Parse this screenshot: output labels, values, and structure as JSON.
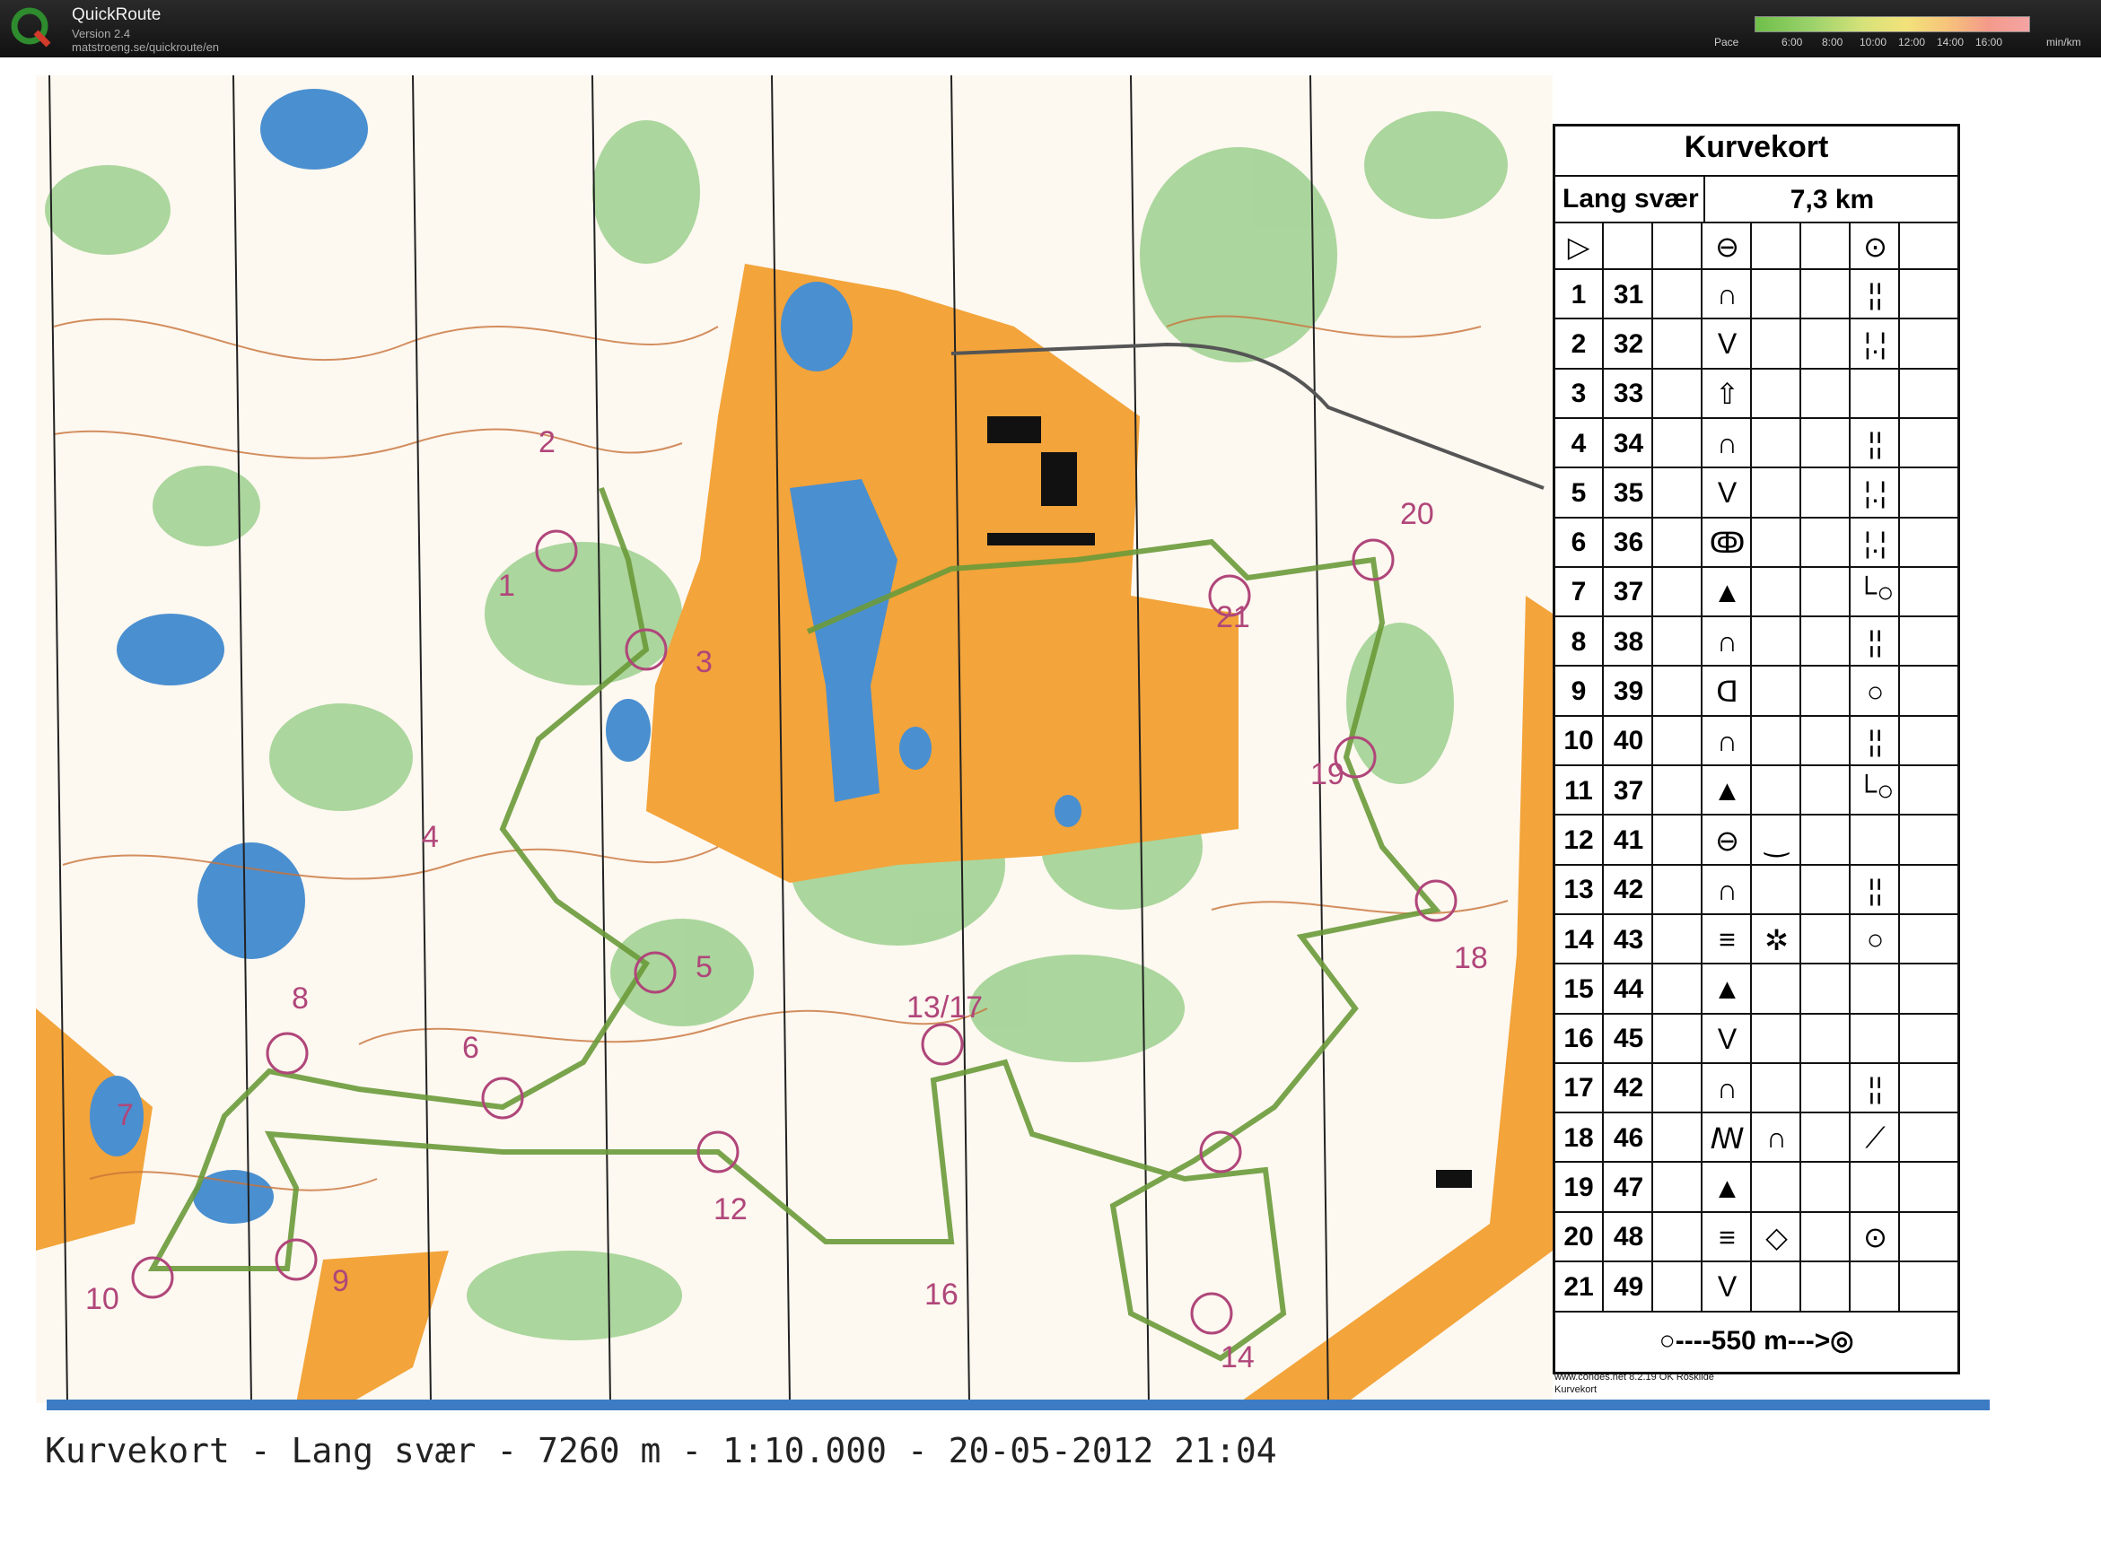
{
  "app": {
    "title": "QuickRoute",
    "version": "Version 2.4",
    "url": "matstroeng.se/quickroute/en"
  },
  "pace_legend": {
    "label": "Pace",
    "ticks": [
      "6:00",
      "8:00",
      "10:00",
      "12:00",
      "14:00",
      "16:00"
    ],
    "unit": "min/km"
  },
  "map": {
    "control_labels": [
      "1",
      "2",
      "3",
      "4",
      "5",
      "6",
      "7",
      "8",
      "9",
      "10",
      "12",
      "13/17",
      "14",
      "16",
      "18",
      "19",
      "20",
      "21"
    ]
  },
  "description_sheet": {
    "title": "Kurvekort",
    "course_name": "Lang svær",
    "course_length": "7,3 km",
    "controls": [
      {
        "num": "1",
        "code": "31",
        "feature": "∩",
        "detail": "",
        "loc": "¦¦"
      },
      {
        "num": "2",
        "code": "32",
        "feature": "V",
        "detail": "",
        "loc": "¦.¦"
      },
      {
        "num": "3",
        "code": "33",
        "feature": "⇧",
        "detail": "",
        "loc": ""
      },
      {
        "num": "4",
        "code": "34",
        "feature": "∩",
        "detail": "",
        "loc": "¦¦"
      },
      {
        "num": "5",
        "code": "35",
        "feature": "V",
        "detail": "",
        "loc": "¦.¦"
      },
      {
        "num": "6",
        "code": "36",
        "feature": "ↂ",
        "detail": "",
        "loc": "¦.¦"
      },
      {
        "num": "7",
        "code": "37",
        "feature": "▲",
        "detail": "",
        "loc": "└○"
      },
      {
        "num": "8",
        "code": "38",
        "feature": "∩",
        "detail": "",
        "loc": "¦¦"
      },
      {
        "num": "9",
        "code": "39",
        "feature": "ᗡ",
        "detail": "",
        "loc": "○"
      },
      {
        "num": "10",
        "code": "40",
        "feature": "∩",
        "detail": "",
        "loc": "¦¦"
      },
      {
        "num": "11",
        "code": "37",
        "feature": "▲",
        "detail": "",
        "loc": "└○"
      },
      {
        "num": "12",
        "code": "41",
        "feature": "⊖",
        "detail": "‿",
        "loc": ""
      },
      {
        "num": "13",
        "code": "42",
        "feature": "∩",
        "detail": "",
        "loc": "¦¦"
      },
      {
        "num": "14",
        "code": "43",
        "feature": "≡",
        "detail": "✲",
        "loc": "○"
      },
      {
        "num": "15",
        "code": "44",
        "feature": "▲",
        "detail": "",
        "loc": ""
      },
      {
        "num": "16",
        "code": "45",
        "feature": "V",
        "detail": "",
        "loc": ""
      },
      {
        "num": "17",
        "code": "42",
        "feature": "∩",
        "detail": "",
        "loc": "¦¦"
      },
      {
        "num": "18",
        "code": "46",
        "feature": "ꟿ",
        "detail": "∩",
        "loc": "⟋"
      },
      {
        "num": "19",
        "code": "47",
        "feature": "▲",
        "detail": "",
        "loc": ""
      },
      {
        "num": "20",
        "code": "48",
        "feature": "≡",
        "detail": "◇",
        "loc": "⊙"
      },
      {
        "num": "21",
        "code": "49",
        "feature": "V",
        "detail": "",
        "loc": ""
      }
    ],
    "finish": "○----550 m--->◎",
    "credit_line1": "www.condes.net 8.2.19 OK Roskilde",
    "credit_line2": "Kurvekort"
  },
  "footer": {
    "caption": "Kurvekort - Lang svær - 7260 m - 1:10.000 - 20-05-2012 21:04"
  },
  "colors": {
    "open_land": "#f3a43a",
    "water": "#4a8fd0",
    "forest_green": "#7ec07a",
    "contour": "#c8733a",
    "control_circle": "#b0467a",
    "route": "#6a9a3a"
  }
}
